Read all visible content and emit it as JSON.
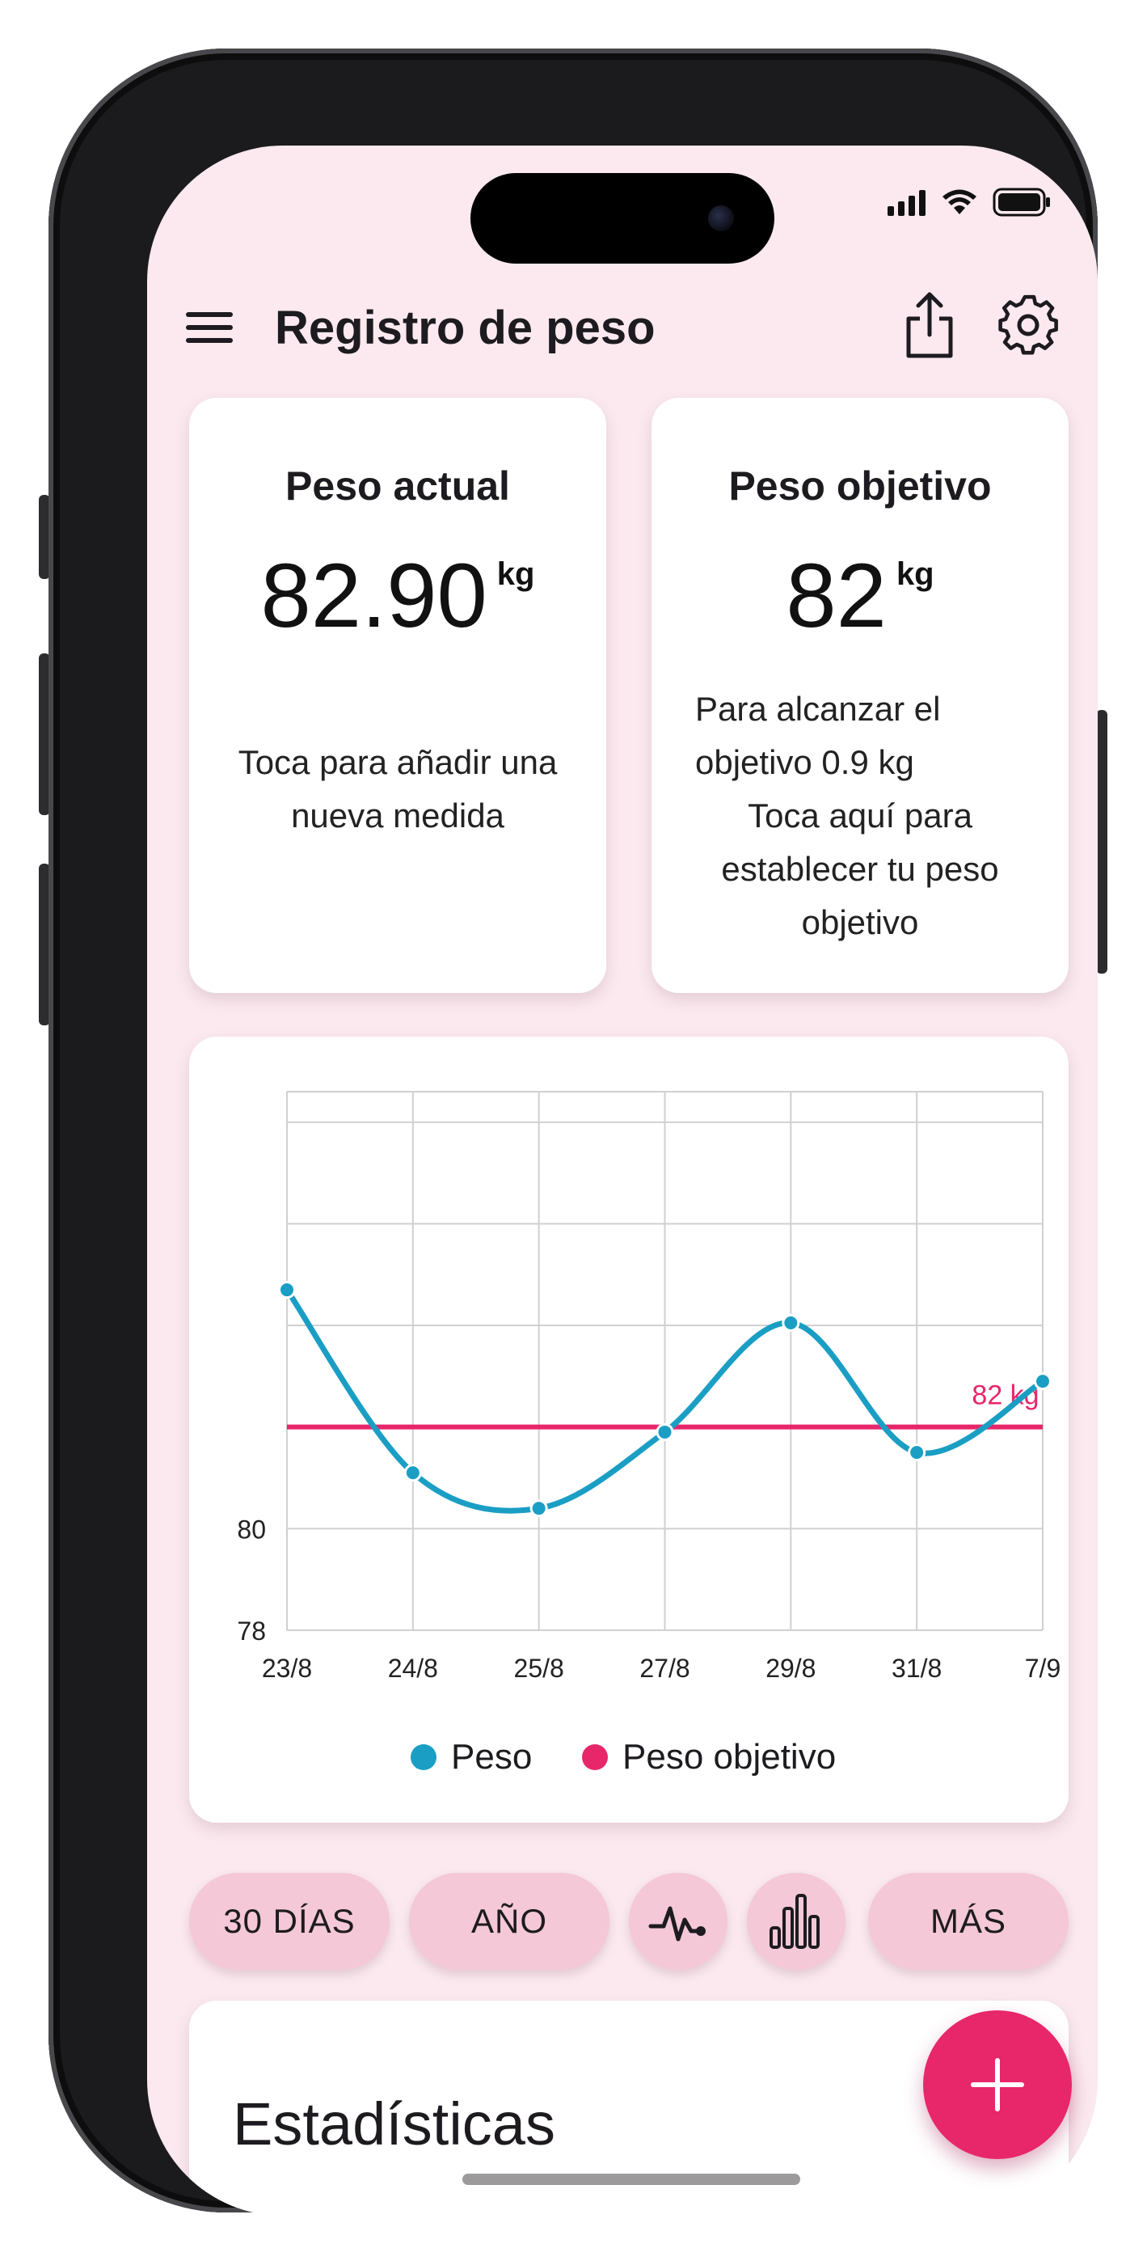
{
  "app": {
    "title": "Registro de peso",
    "icons": {
      "menu": "hamburger-menu-icon",
      "share": "share-icon",
      "settings": "gear-icon",
      "add": "plus-icon"
    }
  },
  "current_weight": {
    "title": "Peso actual",
    "value": "82.90",
    "unit": "kg",
    "hint": "Toca para añadir una nueva medida"
  },
  "target_weight": {
    "title": "Peso objetivo",
    "value": "82",
    "unit": "kg",
    "remaining": "Para alcanzar el objetivo 0.9 kg",
    "hint": "Toca aquí para establecer tu peso objetivo"
  },
  "chart_data": {
    "type": "line",
    "categories": [
      "23/8",
      "24/8",
      "25/8",
      "27/8",
      "29/8",
      "31/8",
      "7/9"
    ],
    "series": [
      {
        "name": "Peso",
        "color": "#1a9ec4",
        "values": [
          84.7,
          81.1,
          80.4,
          81.9,
          84.05,
          81.5,
          82.9
        ]
      },
      {
        "name": "Peso objetivo",
        "color": "#e8266a",
        "values": [
          82,
          82,
          82,
          82,
          82,
          82,
          82
        ]
      }
    ],
    "target_label": "82 kg",
    "y_ticks": [
      "78",
      "80"
    ],
    "ylim": [
      78,
      88.6
    ],
    "grid": true,
    "legend": "bottom-center"
  },
  "filters": {
    "chip_30": "30 DÍAS",
    "chip_year": "AÑO",
    "chip_more": "MÁS",
    "line_icon": "activity-line-icon",
    "bars_icon": "bar-chart-icon"
  },
  "stats": {
    "title": "Estadísticas"
  }
}
